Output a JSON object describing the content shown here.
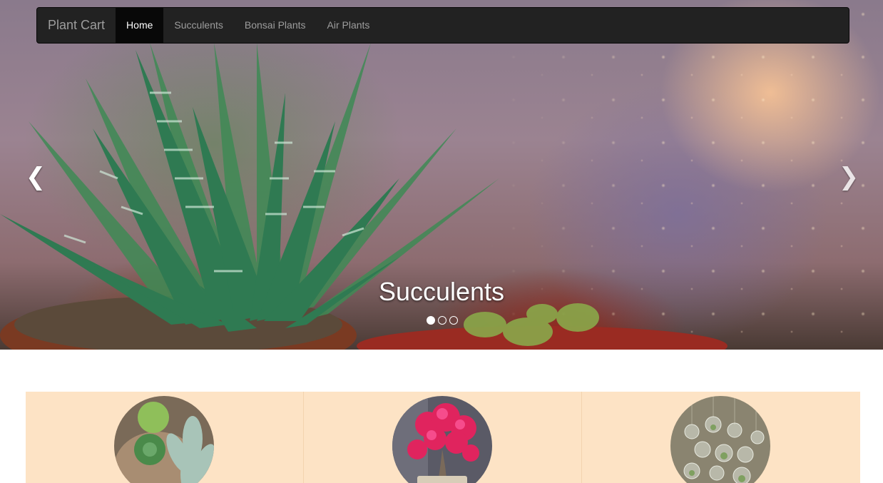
{
  "navbar": {
    "brand": "Plant Cart",
    "links": [
      {
        "label": "Home",
        "active": true
      },
      {
        "label": "Succulents",
        "active": false
      },
      {
        "label": "Bonsai Plants",
        "active": false
      },
      {
        "label": "Air Plants",
        "active": false
      }
    ]
  },
  "carousel": {
    "caption": "Succulents",
    "prev_icon": "chevron-left-icon",
    "next_icon": "chevron-right-icon",
    "prev_glyph": "❮",
    "next_glyph": "❯",
    "slide_count": 3,
    "active_slide": 1
  },
  "cards": [
    {
      "name": "succulents-thumbnail"
    },
    {
      "name": "bonsai-thumbnail"
    },
    {
      "name": "air-plants-thumbnail"
    }
  ],
  "colors": {
    "navbar_bg": "#222222",
    "card_bg": "#fde3c5"
  }
}
